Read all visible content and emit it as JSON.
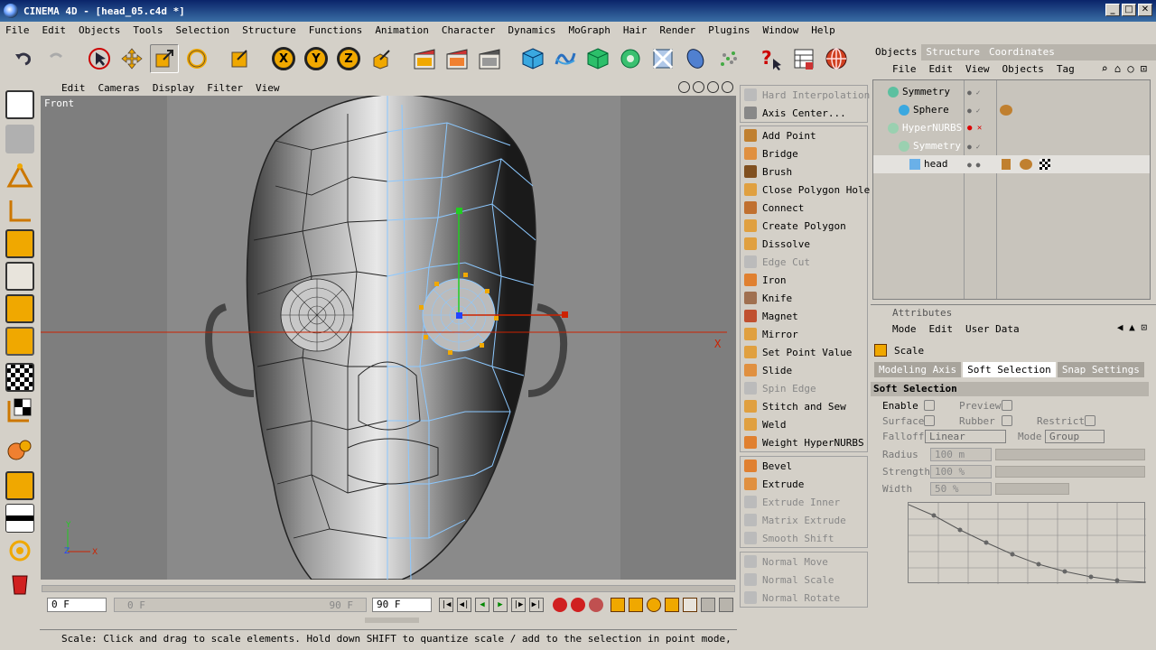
{
  "window": {
    "title": "CINEMA 4D - [head_05.c4d *]"
  },
  "menu": [
    "File",
    "Edit",
    "Objects",
    "Tools",
    "Selection",
    "Structure",
    "Functions",
    "Animation",
    "Character",
    "Dynamics",
    "MoGraph",
    "Hair",
    "Render",
    "Plugins",
    "Window",
    "Help"
  ],
  "viewport": {
    "menu": [
      "Edit",
      "Cameras",
      "Display",
      "Filter",
      "View"
    ],
    "label": "Front",
    "axis_x": "X"
  },
  "timeline": {
    "current": "0 F",
    "slider_start": "0 F",
    "slider_end": "90 F",
    "end": "90 F"
  },
  "status": "Scale: Click and drag to scale elements. Hold down SHIFT to quantize scale / add to the selection in point mode, CTRL to rem",
  "palette": {
    "group1": [
      "Hard Interpolation",
      "Axis Center..."
    ],
    "group2": [
      "Add Point",
      "Bridge",
      "Brush",
      "Close Polygon Hole",
      "Connect",
      "Create Polygon",
      "Dissolve",
      "Edge Cut",
      "Iron",
      "Knife",
      "Magnet",
      "Mirror",
      "Set Point Value",
      "Slide",
      "Spin Edge",
      "Stitch and Sew",
      "Weld",
      "Weight HyperNURBS"
    ],
    "group3": [
      "Bevel",
      "Extrude",
      "Extrude Inner",
      "Matrix Extrude",
      "Smooth Shift"
    ],
    "group4": [
      "Normal Move",
      "Normal Scale",
      "Normal Rotate"
    ]
  },
  "objects": {
    "tabs": [
      "Objects",
      "Structure",
      "Coordinates"
    ],
    "menu": [
      "File",
      "Edit",
      "View",
      "Objects",
      "Tag"
    ],
    "tree": [
      {
        "name": "Symmetry",
        "indent": 1,
        "dim": false
      },
      {
        "name": "Sphere",
        "indent": 2,
        "dim": false
      },
      {
        "name": "HyperNURBS",
        "indent": 1,
        "dim": true
      },
      {
        "name": "Symmetry",
        "indent": 2,
        "dim": true
      },
      {
        "name": "head",
        "indent": 3,
        "dim": false
      }
    ]
  },
  "attributes": {
    "header": "Attributes",
    "menu": [
      "Mode",
      "Edit",
      "User Data"
    ],
    "tool": "Scale",
    "tabs": [
      "Modeling Axis",
      "Soft Selection",
      "Snap Settings"
    ],
    "section": "Soft Selection",
    "enable": "Enable",
    "preview": "Preview",
    "surface": "Surface",
    "rubber": "Rubber",
    "restrict": "Restrict",
    "falloff_label": "Falloff",
    "falloff_value": "Linear",
    "mode_label": "Mode",
    "mode_value": "Group",
    "radius_label": "Radius",
    "radius_value": "100 m",
    "strength_label": "Strength",
    "strength_value": "100 %",
    "width_label": "Width",
    "width_value": "50 %"
  },
  "colors": {
    "accent": "#0a246a",
    "selection": "#f0a800",
    "axis_red": "#cc2200",
    "axis_green": "#22cc22"
  }
}
